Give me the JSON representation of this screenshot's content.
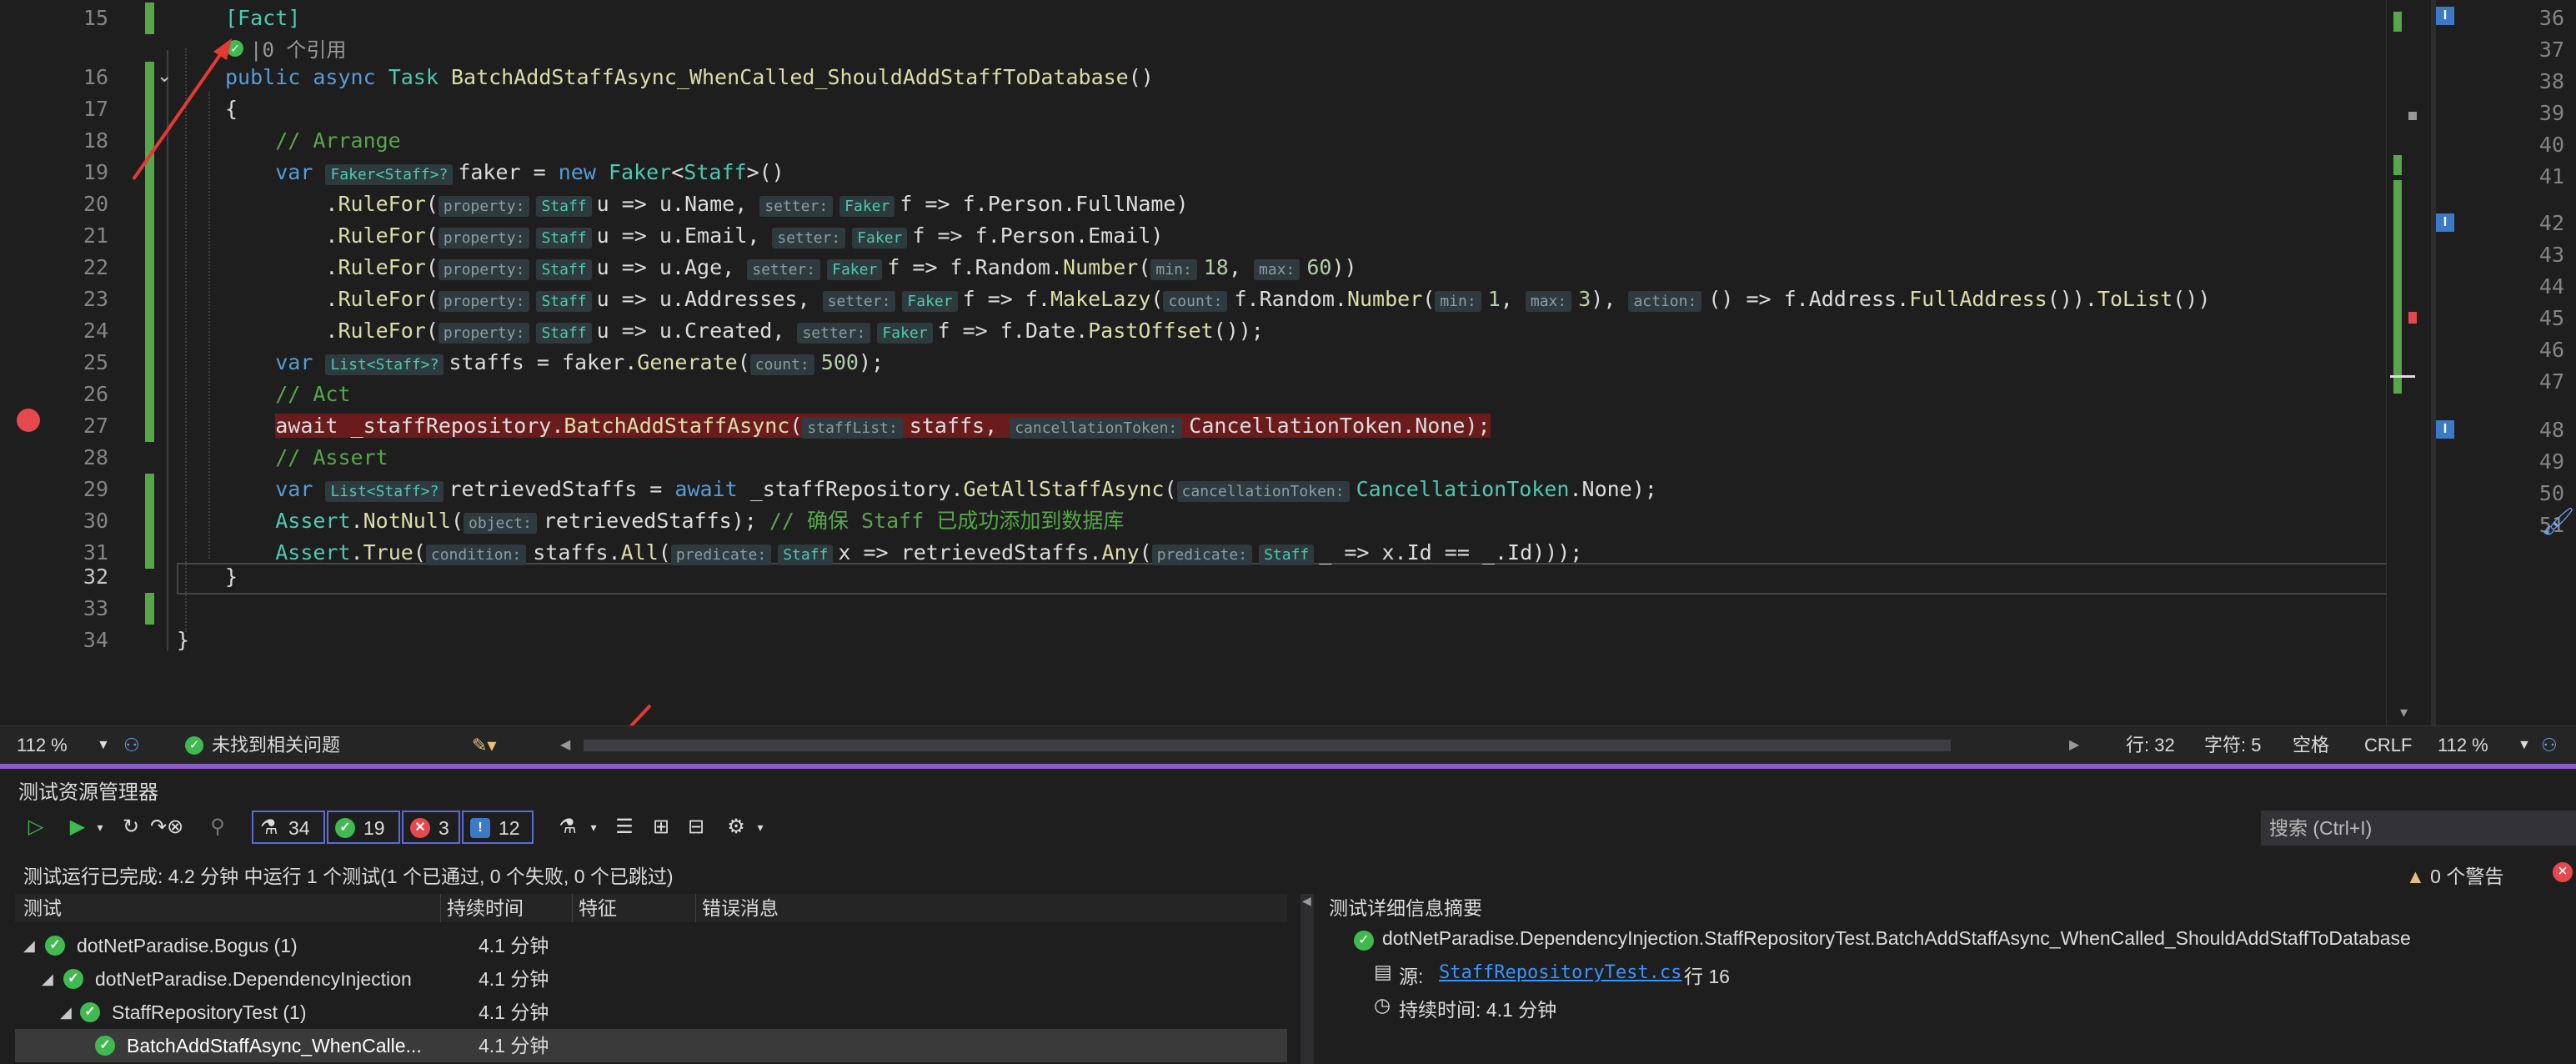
{
  "editor": {
    "codelens": "|0 个引用",
    "line_numbers": [
      "15",
      "16",
      "17",
      "18",
      "19",
      "20",
      "21",
      "22",
      "23",
      "24",
      "25",
      "26",
      "27",
      "28",
      "29",
      "30",
      "31",
      "32",
      "33",
      "34"
    ],
    "right_line_numbers": [
      "36",
      "37",
      "38",
      "39",
      "40",
      "41",
      "42",
      "43",
      "44",
      "45",
      "46",
      "47",
      "48",
      "49",
      "50",
      "51"
    ],
    "current_line": "32"
  },
  "status_bar": {
    "zoom": "112 %",
    "issues": "未找到相关问题",
    "line": "行: 32",
    "char": "字符: 5",
    "spaces": "空格",
    "eol": "CRLF",
    "right_zoom": "112 %"
  },
  "test_explorer": {
    "title": "测试资源管理器",
    "counts": {
      "total": "34",
      "passed": "19",
      "failed": "3",
      "not_run": "12"
    },
    "search_placeholder": "搜索 (Ctrl+I)",
    "summary": "测试运行已完成: 4.2 分钟 中运行 1 个测试(1 个已通过, 0 个失败, 0 个已跳过)",
    "warnings": "0 个警告",
    "columns": [
      "测试",
      "持续时间",
      "特征",
      "错误消息"
    ],
    "rows": [
      {
        "name": "dotNetParadise.Bogus (1)",
        "duration": "4.1 分钟"
      },
      {
        "name": "dotNetParadise.DependencyInjection",
        "duration": "4.1 分钟"
      },
      {
        "name": "StaffRepositoryTest (1)",
        "duration": "4.1 分钟"
      },
      {
        "name": "BatchAddStaffAsync_WhenCalle...",
        "duration": "4.1 分钟"
      }
    ],
    "details": {
      "heading": "测试详细信息摘要",
      "full_name": "dotNetParadise.DependencyInjection.StaffRepositoryTest.BatchAddStaffAsync_WhenCalled_ShouldAddStaffToDatabase",
      "source_label": "源:",
      "source_file": "StaffRepositoryTest.cs",
      "source_line": "行 16",
      "duration": "持续时间: 4.1 分钟"
    }
  },
  "colors": {
    "accent": "#8a5ec8",
    "pass": "#3fb950",
    "fail": "#e5484d",
    "breakpoint": "#e5484d",
    "annotation": "#e53935"
  }
}
